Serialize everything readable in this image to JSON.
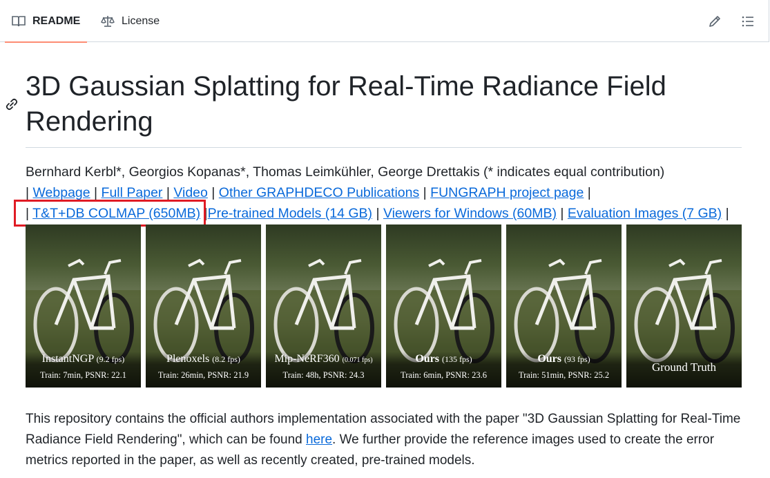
{
  "tabs": {
    "readme": "README",
    "license": "License"
  },
  "toolbar": {
    "edit_icon": "pencil-icon",
    "outline_icon": "list-unordered-icon"
  },
  "heading": {
    "title": "3D Gaussian Splatting for Real-Time Radiance Field Rendering"
  },
  "authors": "Bernhard Kerbl*, Georgios Kopanas*, Thomas Leimkühler, George Drettakis (* indicates equal contribution)",
  "links_row1": [
    "Webpage",
    "Full Paper",
    "Video",
    "Other GRAPHDECO Publications",
    "FUNGRAPH project page"
  ],
  "links_row2": [
    "T&T+DB COLMAP (650MB)",
    "Pre-trained Models (14 GB)",
    "Viewers for Windows (60MB)",
    "Evaluation Images (7 GB)"
  ],
  "separator": "|",
  "comparison": [
    {
      "name": "InstantNGP",
      "fps": "(9.2 fps)",
      "stats": "Train: 7min, PSNR: 22.1"
    },
    {
      "name": "Plenoxels",
      "fps": "(8.2 fps)",
      "stats": "Train: 26min, PSNR: 21.9"
    },
    {
      "name": "Mip-NeRF360",
      "fps": "(0.071 fps)",
      "stats": "Train: 48h, PSNR: 24.3"
    },
    {
      "name": "Ours",
      "fps": "(135 fps)",
      "stats": "Train: 6min, PSNR: 23.6"
    },
    {
      "name": "Ours",
      "fps": "(93 fps)",
      "stats": "Train: 51min, PSNR: 25.2"
    },
    {
      "name": "Ground Truth",
      "fps": "",
      "stats": ""
    }
  ],
  "paragraph": {
    "before": "This repository contains the official authors implementation associated with the paper \"3D Gaussian Splatting for Real-Time Radiance Field Rendering\", which can be found ",
    "link": "here",
    "after": ". We further provide the reference images used to create the error metrics reported in the paper, as well as recently created, pre-trained models."
  },
  "colors": {
    "link": "#0969da",
    "text": "#1f2328",
    "tab_underline": "#fd8c73",
    "highlight_box": "#e01b24",
    "border": "#d1d9e0"
  }
}
